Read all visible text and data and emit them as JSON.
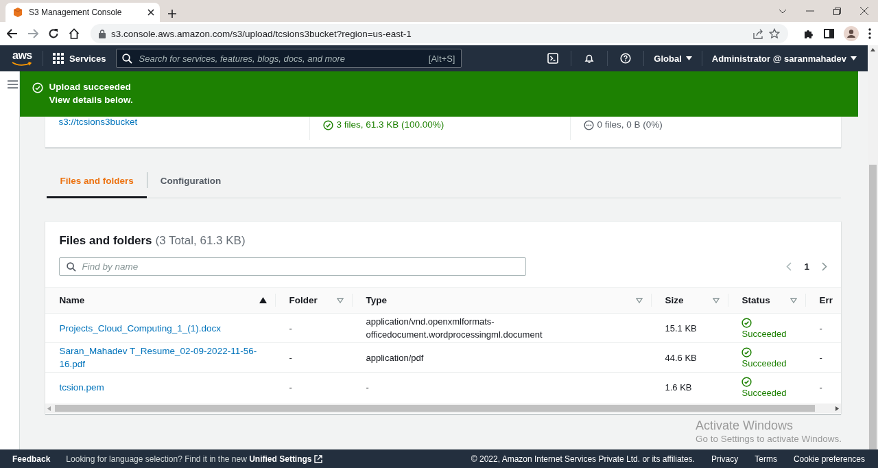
{
  "browser": {
    "tab_title": "S3 Management Console",
    "url": "s3.console.aws.amazon.com/s3/upload/tcsions3bucket?region=us-east-1"
  },
  "nav": {
    "logo_text": "aws",
    "services": "Services",
    "search_placeholder": "Search for services, features, blogs, docs, and more",
    "shortcut": "[Alt+S]",
    "region": "Global",
    "account": "Administrator @ saranmahadev"
  },
  "flash": {
    "title": "Upload succeeded",
    "message": "View details below."
  },
  "summary": {
    "destination": "s3://tcsions3bucket",
    "succeeded": "3 files, 61.3 KB (100.00%)",
    "failed": "0 files, 0 B (0%)"
  },
  "tabs": [
    {
      "label": "Files and folders",
      "selected": true
    },
    {
      "label": "Configuration",
      "selected": false
    }
  ],
  "files": {
    "title": "Files and folders",
    "count": "(3 Total, 61.3 KB)",
    "search": {
      "placeholder": "Find by name"
    },
    "page": "1",
    "columns": [
      {
        "label": "Name",
        "sorted": true
      },
      {
        "label": "Folder",
        "sorted": false
      },
      {
        "label": "Type",
        "sorted": false
      },
      {
        "label": "Size",
        "sorted": false
      },
      {
        "label": "Status",
        "sorted": false
      },
      {
        "label": "Err"
      }
    ],
    "rows": [
      {
        "name": "Projects_Cloud_Computing_1_(1).docx",
        "folder": "-",
        "type": "application/vnd.openxmlformats-officedocument.wordprocessingml.document",
        "size": "15.1 KB",
        "status": "Succeeded",
        "error": "-"
      },
      {
        "name": "Saran_Mahadev T_Resume_02-09-2022-11-56-16.pdf",
        "folder": "-",
        "type": "application/pdf",
        "size": "44.6 KB",
        "status": "Succeeded",
        "error": "-"
      },
      {
        "name": "tcsion.pem",
        "folder": "-",
        "type": "-",
        "size": "1.6 KB",
        "status": "Succeeded",
        "error": "-"
      }
    ]
  },
  "footer": {
    "feedback": "Feedback",
    "notice": "Looking for language selection? Find it in the new ",
    "settings_link": "Unified Settings",
    "copyright": "© 2022, Amazon Internet Services Private Ltd. or its affiliates.",
    "links": [
      "Privacy",
      "Terms",
      "Cookie preferences"
    ]
  },
  "os_notice": {
    "title": "Activate Windows",
    "message": "Go to Settings to activate Windows."
  }
}
